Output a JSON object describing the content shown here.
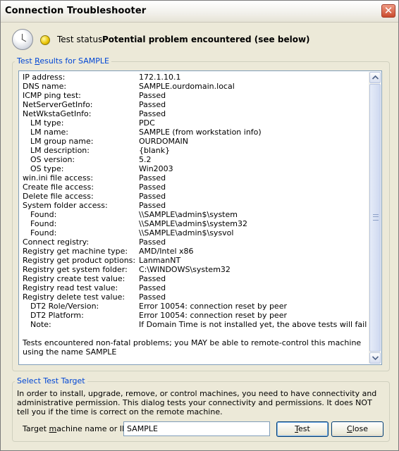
{
  "window": {
    "title": "Connection Troubleshooter",
    "close_glyph": "✕"
  },
  "status": {
    "label": "Test status:",
    "value": "Potential problem encountered (see below)",
    "light_color": "#e9c200"
  },
  "results": {
    "legend_pre": "Test ",
    "legend_mnemonic": "R",
    "legend_post": "esults for SAMPLE",
    "rows": [
      {
        "key": "IP address:",
        "value": "172.1.10.1",
        "indent": false
      },
      {
        "key": "DNS name:",
        "value": "SAMPLE.ourdomain.local",
        "indent": false
      },
      {
        "key": "ICMP ping test:",
        "value": "Passed",
        "indent": false
      },
      {
        "key": "NetServerGetInfo:",
        "value": "Passed",
        "indent": false
      },
      {
        "key": "NetWkstaGetInfo:",
        "value": "Passed",
        "indent": false
      },
      {
        "key": "LM type:",
        "value": "PDC",
        "indent": true
      },
      {
        "key": "LM name:",
        "value": "SAMPLE (from workstation info)",
        "indent": true
      },
      {
        "key": "LM group name:",
        "value": "OURDOMAIN",
        "indent": true
      },
      {
        "key": "LM description:",
        "value": "{blank}",
        "indent": true
      },
      {
        "key": "OS version:",
        "value": "5.2",
        "indent": true
      },
      {
        "key": "OS type:",
        "value": "Win2003",
        "indent": true
      },
      {
        "key": "win.ini file access:",
        "value": "Passed",
        "indent": false
      },
      {
        "key": "Create file access:",
        "value": "Passed",
        "indent": false
      },
      {
        "key": "Delete file access:",
        "value": "Passed",
        "indent": false
      },
      {
        "key": "System folder access:",
        "value": "Passed",
        "indent": false
      },
      {
        "key": "Found:",
        "value": "\\\\SAMPLE\\admin$\\system",
        "indent": true
      },
      {
        "key": "Found:",
        "value": "\\\\SAMPLE\\admin$\\system32",
        "indent": true
      },
      {
        "key": "Found:",
        "value": "\\\\SAMPLE\\admin$\\sysvol",
        "indent": true
      },
      {
        "key": "Connect registry:",
        "value": "Passed",
        "indent": false
      },
      {
        "key": "Registry get machine type:",
        "value": "AMD/Intel x86",
        "indent": false
      },
      {
        "key": "Registry get product options:",
        "value": "LanmanNT",
        "indent": false
      },
      {
        "key": "Registry get system folder:",
        "value": "C:\\WINDOWS\\system32",
        "indent": false
      },
      {
        "key": "Registry create test value:",
        "value": "Passed",
        "indent": false
      },
      {
        "key": "Registry read test value:",
        "value": "Passed",
        "indent": false
      },
      {
        "key": "Registry delete test value:",
        "value": "Passed",
        "indent": false
      },
      {
        "key": "DT2 Role/Version:",
        "value": "Error 10054: connection reset by peer",
        "indent": true
      },
      {
        "key": "DT2 Platform:",
        "value": "Error 10054: connection reset by peer",
        "indent": true
      },
      {
        "key": "Note:",
        "value": "If Domain Time is not installed yet, the above tests will fail",
        "indent": true
      }
    ],
    "conclusion": "Tests encountered non-fatal problems; you MAY be able to remote-control this machine using the name SAMPLE"
  },
  "target": {
    "legend": "Select Test Target",
    "explanation": "In order to install, upgrade, remove, or control machines, you need to have connectivity and administrative permission. This dialog tests your connectivity and permissions. It does NOT tell you if the time is correct on the remote machine.",
    "input_label_pre": "Target ",
    "input_label_mnemonic": "m",
    "input_label_post": "achine name or IP:",
    "input_value": "SAMPLE",
    "test_label_mnemonic": "T",
    "test_label_post": "est",
    "close_label_mnemonic": "C",
    "close_label_post": "lose"
  }
}
